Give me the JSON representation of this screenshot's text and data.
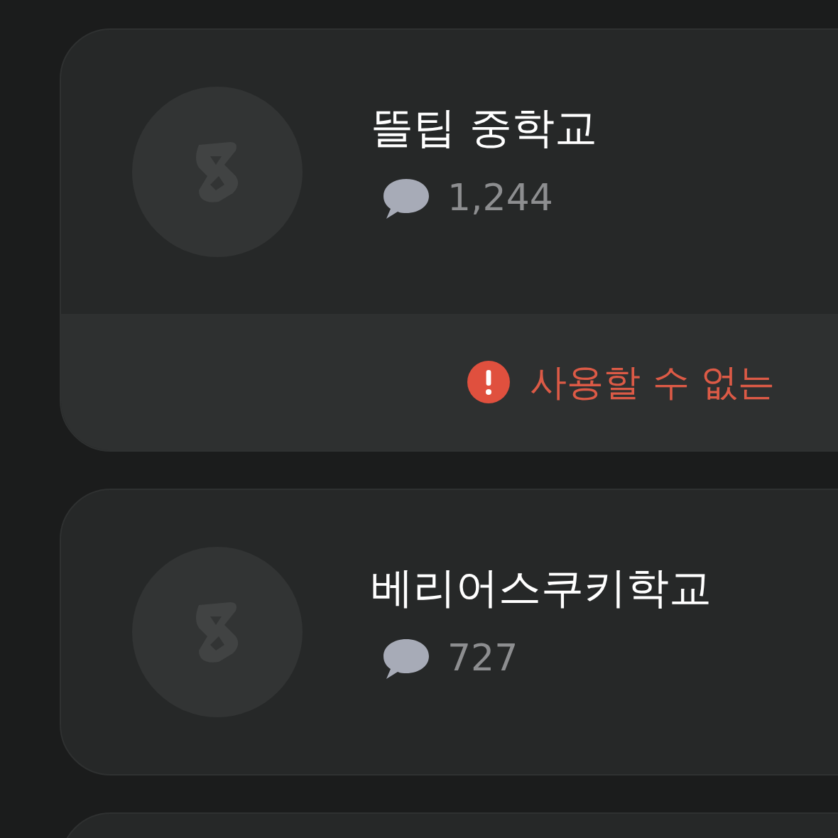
{
  "schools": [
    {
      "name": "뜰팁 중학교",
      "comments": "1,244",
      "warning": "사용할 수 없는"
    },
    {
      "name": "베리어스쿠키학교",
      "comments": "727"
    }
  ]
}
